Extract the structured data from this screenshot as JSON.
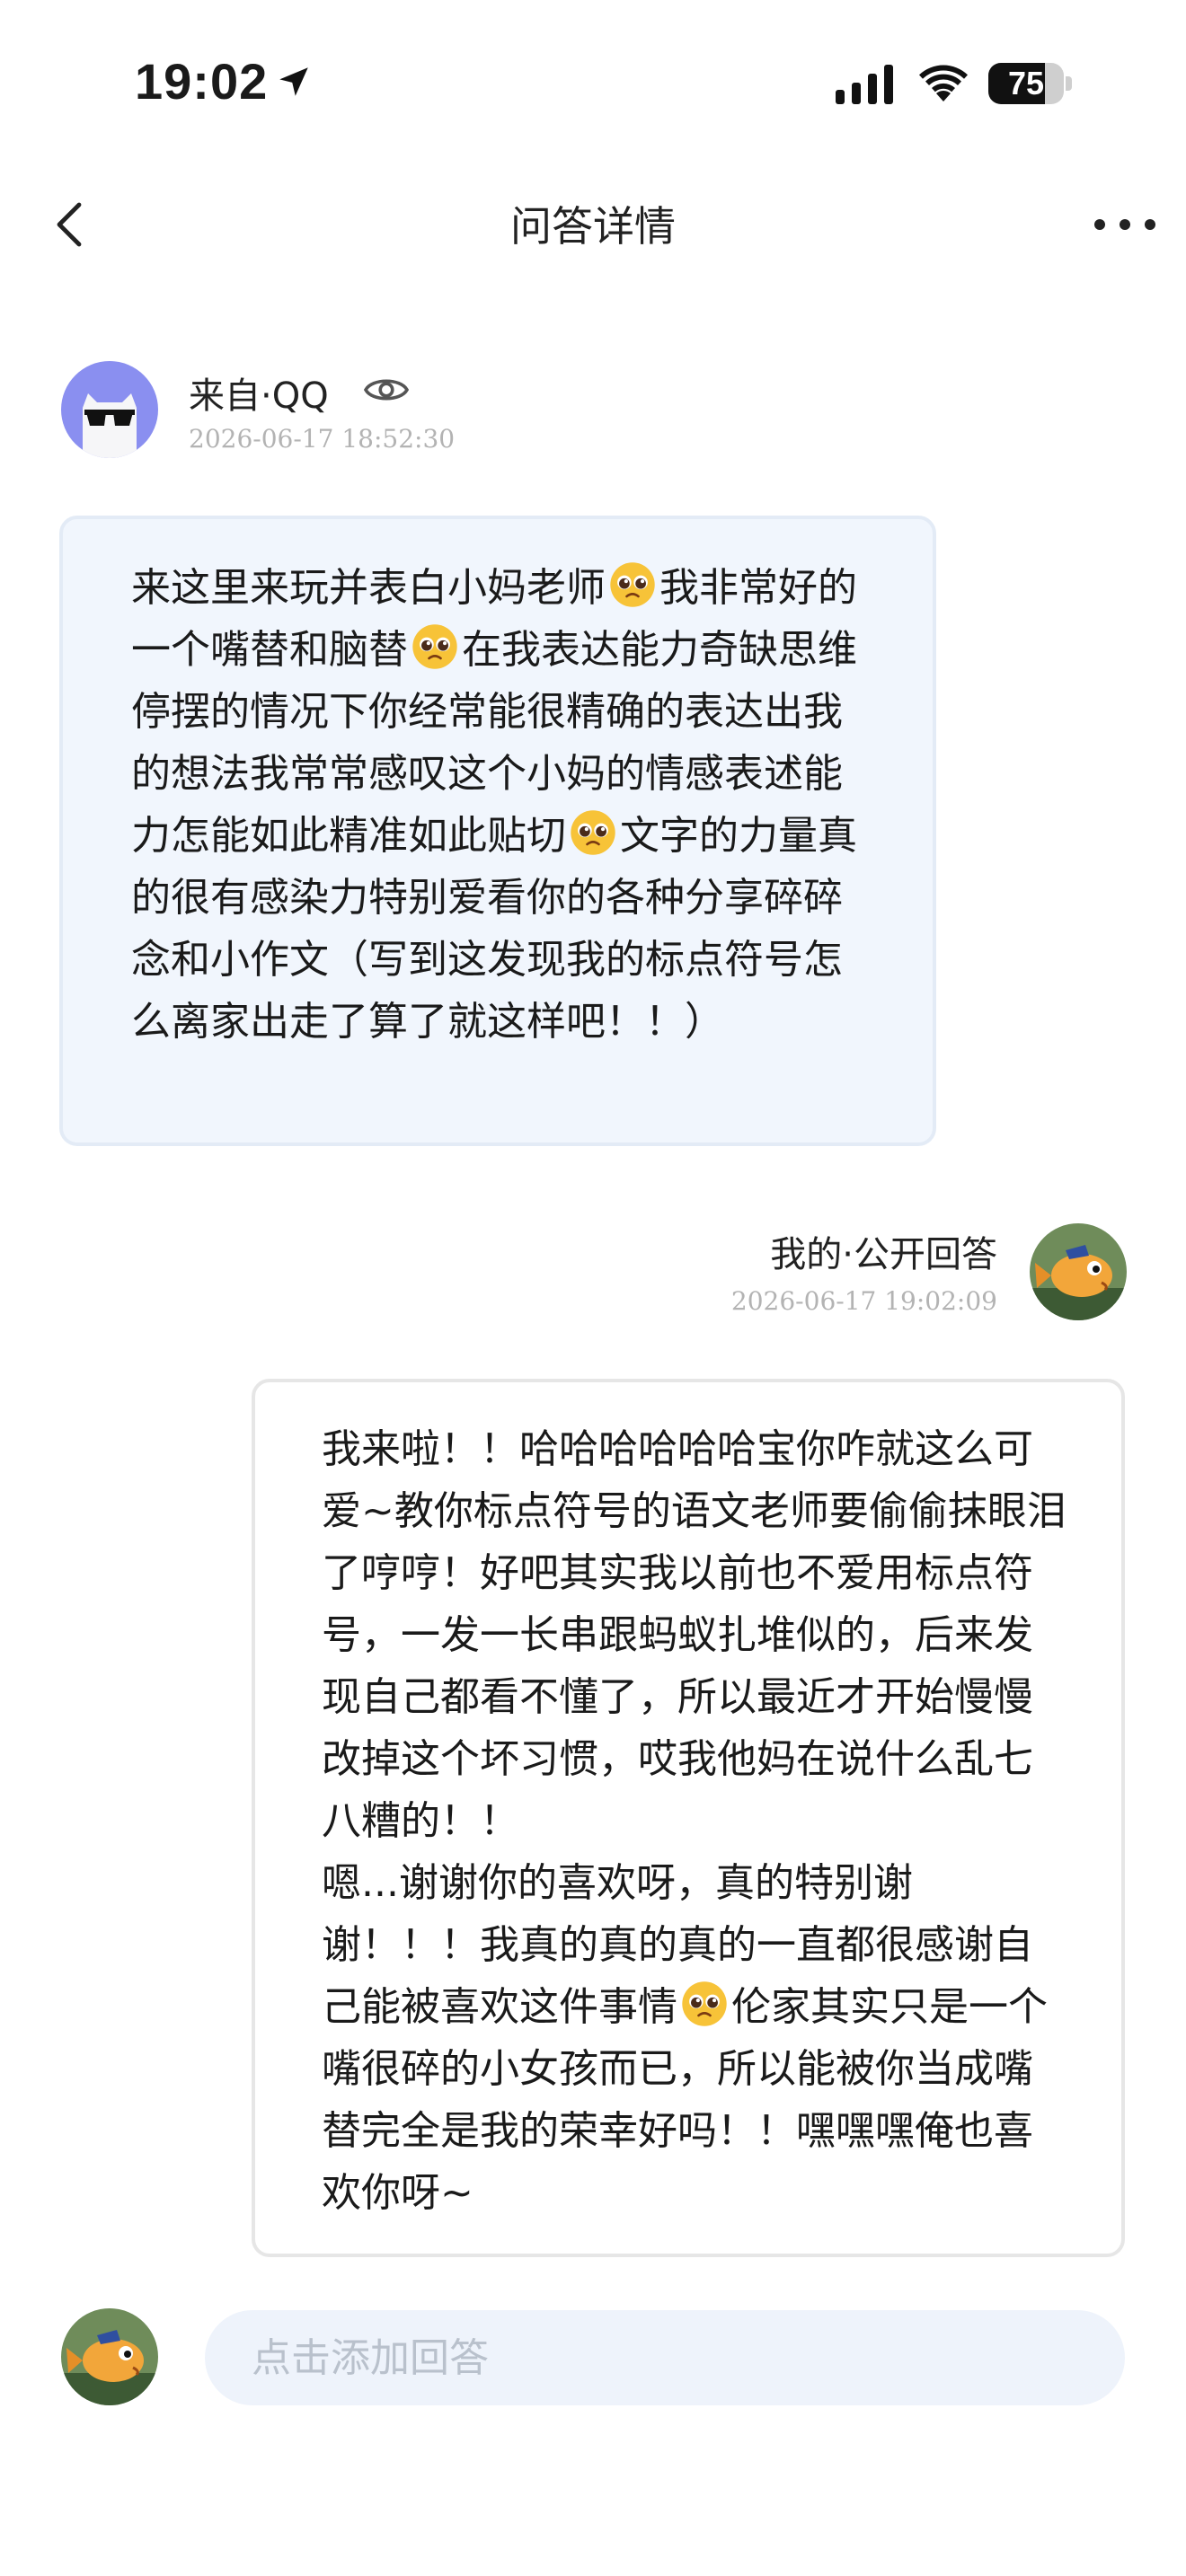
{
  "status_bar": {
    "time": "19:02",
    "battery_level": "75",
    "battery_percent": 75
  },
  "nav": {
    "title": "问答详情",
    "back_icon": "chevron-left-icon",
    "more_icon": "more-horizontal-icon"
  },
  "question": {
    "source": "来自·QQ",
    "timestamp": "2026-06-17 18:52:30",
    "segments": [
      "来这里来玩并表白小妈老师",
      "我非常好的一个嘴替和脑替",
      "在我表达能力奇缺思维停摆的情况下你经常能很精确的表达出我的想法我常常感叹这个小妈的情感表述能力怎能如此精准如此贴切",
      "文字的力量真的很有感染力特别爱看你的各种分享碎碎念和小作文（写到这发现我的标点符号怎么离家出走了算了就这样吧！！）"
    ]
  },
  "answer": {
    "label": "我的·公开回答",
    "timestamp": "2026-06-17 19:02:09",
    "segments": [
      "我来啦！！哈哈哈哈哈哈宝你咋就这么可爱~教你标点符号的语文老师要偷偷抹眼泪了哼哼！好吧其实我以前也不爱用标点符号，一发一长串跟蚂蚁扎堆似的，后来发现自己都看不懂了，所以最近才开始慢慢改掉这个坏习惯，哎我他妈在说什么乱七八糟的！！\n嗯...谢谢你的喜欢呀，真的特别谢谢！！！我真的真的真的一直都很感谢自己能被喜欢这件事情",
      "伦家其实只是一个嘴很碎的小女孩而已，所以能被你当成嘴替完全是我的荣幸好吗！！嘿嘿嘿俺也喜欢你呀~"
    ]
  },
  "reply": {
    "placeholder": "点击添加回答"
  },
  "icons": {
    "location": "location-arrow-icon",
    "signal": "cellular-signal-icon",
    "wifi": "wifi-icon",
    "battery": "battery-icon",
    "eye": "eye-icon",
    "emoji": "pleading-face-emoji"
  },
  "colors": {
    "question_bubble": "#f1f6fd",
    "answer_bubble_border": "#e6e6e6",
    "avatar_purple": "#8a8ff0",
    "input_bg": "#eef3fb"
  }
}
